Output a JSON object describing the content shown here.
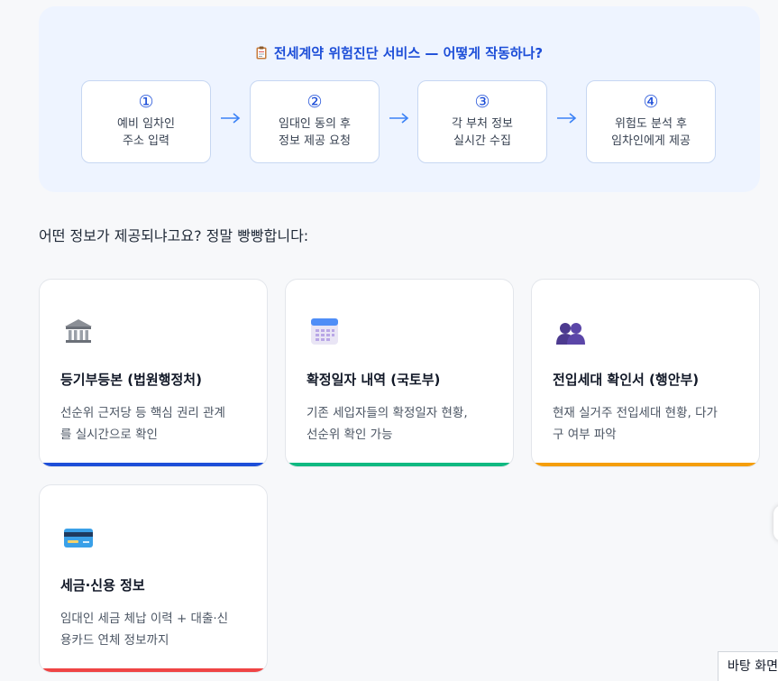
{
  "flow": {
    "title": "전세계약 위험진단 서비스 — 어떻게 작동하나?",
    "steps": [
      {
        "num": "①",
        "text": "예비 임차인\n주소 입력"
      },
      {
        "num": "②",
        "text": "임대인 동의 후\n정보 제공 요청"
      },
      {
        "num": "③",
        "text": "각 부처 정보\n실시간 수집"
      },
      {
        "num": "④",
        "text": "위험도 분석 후\n임차인에게 제공"
      }
    ],
    "arrow": "→",
    "accent": "#1d4ed8",
    "background": "#eef4ff"
  },
  "intro": "어떤 정보가 제공되냐고요? 정말 빵빵합니다:",
  "cards": [
    {
      "icon": "bank-icon",
      "title": "등기부등본 (법원행정처)",
      "desc": "선순위 근저당 등 핵심 권리 관계\n를 실시간으로 확인",
      "color": "#1d4ed8"
    },
    {
      "icon": "calendar-icon",
      "title": "확정일자 내역 (국토부)",
      "desc": "기존 세입자들의 확정일자 현황,\n선순위 확인 가능",
      "color": "#10b981"
    },
    {
      "icon": "people-icon",
      "title": "전입세대 확인서 (행안부)",
      "desc": "현재 실거주 전입세대 현황, 다가\n구 여부 파악",
      "color": "#f59e0b"
    },
    {
      "icon": "credit-card-icon",
      "title": "세금·신용 정보",
      "desc": "임대인 세금 체납 이력 + 대출·신\n용카드 연체 정보까지",
      "color": "#ef4444"
    }
  ],
  "tooltip": "바탕 화면"
}
